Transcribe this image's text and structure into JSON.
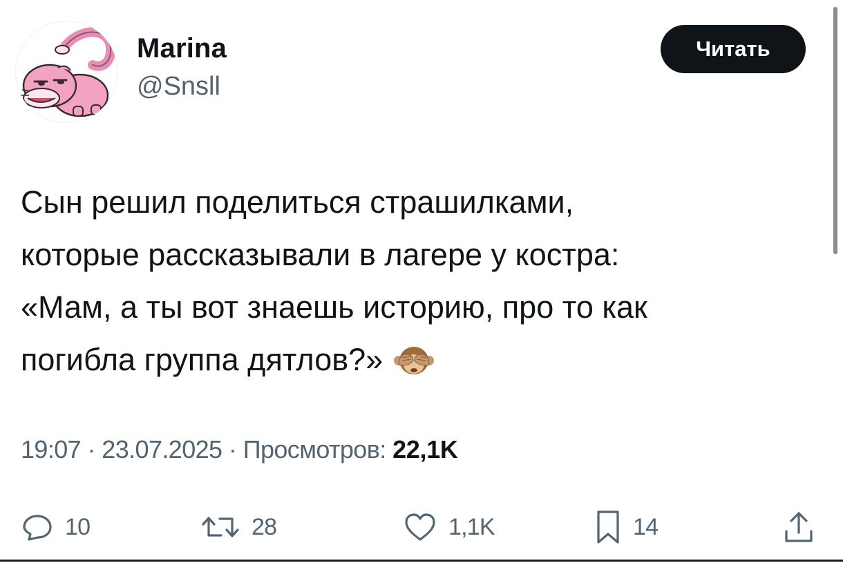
{
  "author": {
    "name": "Marina",
    "handle": "@Snsll",
    "avatar_icon": "slowpoke-avatar"
  },
  "follow_button": {
    "label": "Читать"
  },
  "tweet": {
    "lines": [
      "Сын решил поделиться страшилками,",
      "которые рассказывали в лагере у костра:",
      "«Мам, а ты вот знаешь историю, про то как",
      "погибла группа дятлов?»"
    ],
    "emoji": "see-no-evil-monkey"
  },
  "meta": {
    "time": "19:07",
    "separator": "·",
    "date": "23.07.2025",
    "views_label": "Просмотров:",
    "views_count": "22,1K"
  },
  "actions": {
    "replies": "10",
    "reposts": "28",
    "likes": "1,1K",
    "bookmarks": "14"
  },
  "colors": {
    "text_primary": "#0f1419",
    "text_secondary": "#536471",
    "button_bg": "#0f1419",
    "avatar_pink": "#f2a3c3"
  }
}
